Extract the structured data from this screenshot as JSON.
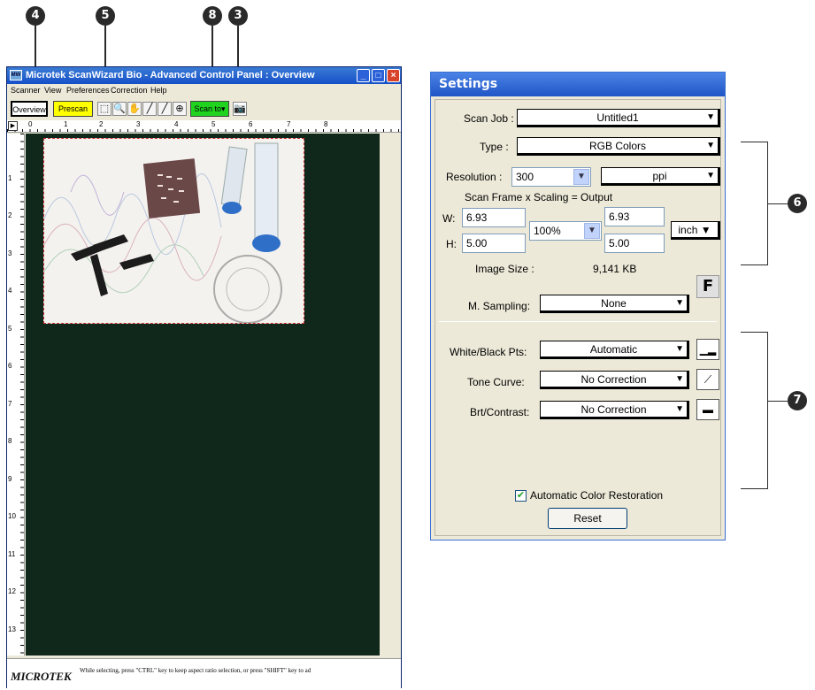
{
  "callouts": {
    "c4": "4",
    "c5": "5",
    "c8": "8",
    "c3": "3",
    "c6": "6",
    "c7": "7"
  },
  "window": {
    "title": "Microtek ScanWizard Bio - Advanced Control Panel : Overview",
    "menu": [
      "Scanner",
      "View",
      "Preferences",
      "Correction",
      "Help"
    ],
    "overview_label": "Overview",
    "prescan_label": "Prescan",
    "scan_to_label": "Scan to",
    "hruler_numbers": [
      "0",
      "1",
      "2",
      "3",
      "4",
      "5",
      "6",
      "7",
      "8"
    ],
    "vruler_numbers": [
      "1",
      "2",
      "3",
      "4",
      "5",
      "6",
      "7",
      "8",
      "9",
      "10",
      "11",
      "12",
      "13"
    ],
    "logo": "MICROTEK",
    "status_hint": "While selecting, press \"CTRL\" key to keep aspect ratio selection, or press \"SHIFT\" key to ad"
  },
  "settings": {
    "title": "Settings",
    "scan_job_label": "Scan Job :",
    "scan_job_value": "Untitled1",
    "type_label": "Type :",
    "type_value": "RGB Colors",
    "resolution_label": "Resolution :",
    "resolution_value": "300",
    "resolution_unit": "ppi",
    "frame_header": "Scan Frame  x  Scaling  =  Output",
    "w_label": "W:",
    "h_label": "H:",
    "w_value": "6.93",
    "h_value": "5.00",
    "scaling_value": "100%",
    "out_w": "6.93",
    "out_h": "5.00",
    "unit_value": "inch",
    "image_size_label": "Image Size :",
    "image_size_value": "9,141 KB",
    "f_label": "F",
    "msampling_label": "M. Sampling:",
    "msampling_value": "None",
    "wb_label": "White/Black Pts:",
    "wb_value": "Automatic",
    "tone_label": "Tone Curve:",
    "tone_value": "No Correction",
    "brt_label": "Brt/Contrast:",
    "brt_value": "No Correction",
    "acr_label": "Automatic Color Restoration",
    "acr_checked": true,
    "reset_label": "Reset"
  },
  "colors": {
    "titlebar": "#1f55c6",
    "scan_bg": "#10271c",
    "prescan_yellow": "#ffff00",
    "scanto_green": "#1fd31f"
  }
}
